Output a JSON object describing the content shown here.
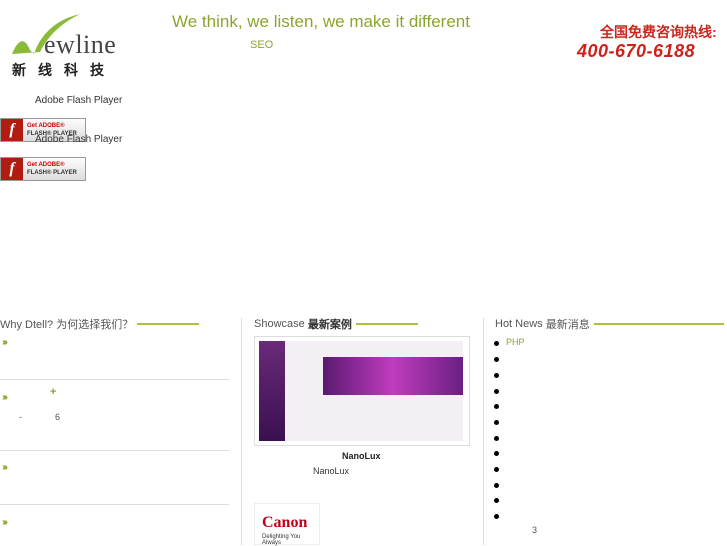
{
  "header": {
    "logo_word": "ewline",
    "logo_cn": "新线科技",
    "slogan": "We think, we listen, we make it different",
    "seo": "SEO",
    "hotline_label": "全国免费咨询热线:",
    "hotline_number": "400-670-6188"
  },
  "flash": {
    "text1": "Adobe Flash Player",
    "text2": "Adobe Flash Player",
    "button_line1": "Get ADOBE®",
    "button_line2": "FLASH® PLAYER",
    "icon_glyph": "f"
  },
  "why": {
    "title": "Why Dtell? 为何选择我们？",
    "items": [
      {
        "extra": ""
      },
      {
        "extra": "+",
        "sub_dash": "-",
        "sub_num": "6"
      },
      {
        "extra": ""
      },
      {
        "extra": ""
      }
    ]
  },
  "showcase": {
    "title_en": "Showcase",
    "title_cn": "最新案例",
    "caption_bold": "NanoLux",
    "caption": "NanoLux",
    "canon_word": "Canon",
    "canon_tag": "Delighting You Always"
  },
  "news": {
    "title_en": "Hot News",
    "title_cn": "最新消息",
    "first_item": "PHP",
    "page_num": "3"
  },
  "colors": {
    "accent": "#a9c43a",
    "hotline": "#d0201a"
  }
}
